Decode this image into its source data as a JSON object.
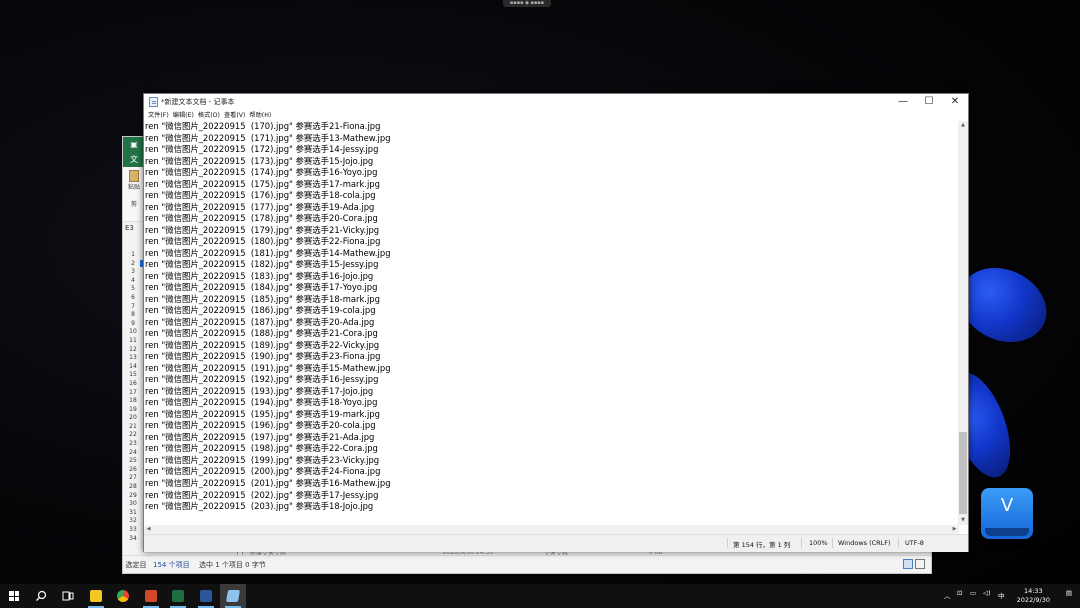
{
  "top_tab": "▪▪▪▪ ◆ ▪▪▪▪",
  "excel": {
    "tab_label": "文",
    "paste_label": "粘贴",
    "clipboard_label": "剪",
    "name_box": "E3",
    "row_numbers": [
      "1",
      "2",
      "3",
      "4",
      "5",
      "6",
      "7",
      "8",
      "9",
      "10",
      "11",
      "12",
      "13",
      "14",
      "15",
      "16",
      "17",
      "18",
      "19",
      "20",
      "21",
      "22",
      "23",
      "24",
      "25",
      "26",
      "27",
      "28",
      "29",
      "30",
      "31",
      "32",
      "33",
      "34"
    ],
    "peek_row": {
      "name": "新建文本文档",
      "date": "2022/9/30 14:53",
      "type": "文本文档",
      "size": "0 KB"
    },
    "status": {
      "mode": "选定目",
      "count": "154 个项目",
      "selection": "选中 1 个项目  0 字节"
    }
  },
  "notepad": {
    "title": "*新建文本文档 - 记事本",
    "window_buttons": {
      "minimize": "—",
      "maximize": "☐",
      "close": "✕"
    },
    "menu": [
      "文件(F)",
      "编辑(E)",
      "格式(O)",
      "查看(V)",
      "帮助(H)"
    ],
    "lines": [
      "ren \"微信图片_20220915  (170).jpg\" 参赛选手21-Fiona.jpg",
      "ren \"微信图片_20220915  (171).jpg\" 参赛选手13-Mathew.jpg",
      "ren \"微信图片_20220915  (172).jpg\" 参赛选手14-Jessy.jpg",
      "ren \"微信图片_20220915  (173).jpg\" 参赛选手15-Jojo.jpg",
      "ren \"微信图片_20220915  (174).jpg\" 参赛选手16-Yoyo.jpg",
      "ren \"微信图片_20220915  (175).jpg\" 参赛选手17-mark.jpg",
      "ren \"微信图片_20220915  (176).jpg\" 参赛选手18-cola.jpg",
      "ren \"微信图片_20220915  (177).jpg\" 参赛选手19-Ada.jpg",
      "ren \"微信图片_20220915  (178).jpg\" 参赛选手20-Cora.jpg",
      "ren \"微信图片_20220915  (179).jpg\" 参赛选手21-Vicky.jpg",
      "ren \"微信图片_20220915  (180).jpg\" 参赛选手22-Fiona.jpg",
      "ren \"微信图片_20220915  (181).jpg\" 参赛选手14-Mathew.jpg",
      "ren \"微信图片_20220915  (182).jpg\" 参赛选手15-Jessy.jpg",
      "ren \"微信图片_20220915  (183).jpg\" 参赛选手16-Jojo.jpg",
      "ren \"微信图片_20220915  (184).jpg\" 参赛选手17-Yoyo.jpg",
      "ren \"微信图片_20220915  (185).jpg\" 参赛选手18-mark.jpg",
      "ren \"微信图片_20220915  (186).jpg\" 参赛选手19-cola.jpg",
      "ren \"微信图片_20220915  (187).jpg\" 参赛选手20-Ada.jpg",
      "ren \"微信图片_20220915  (188).jpg\" 参赛选手21-Cora.jpg",
      "ren \"微信图片_20220915  (189).jpg\" 参赛选手22-Vicky.jpg",
      "ren \"微信图片_20220915  (190).jpg\" 参赛选手23-Fiona.jpg",
      "ren \"微信图片_20220915  (191).jpg\" 参赛选手15-Mathew.jpg",
      "ren \"微信图片_20220915  (192).jpg\" 参赛选手16-Jessy.jpg",
      "ren \"微信图片_20220915  (193).jpg\" 参赛选手17-Jojo.jpg",
      "ren \"微信图片_20220915  (194).jpg\" 参赛选手18-Yoyo.jpg",
      "ren \"微信图片_20220915  (195).jpg\" 参赛选手19-mark.jpg",
      "ren \"微信图片_20220915  (196).jpg\" 参赛选手20-cola.jpg",
      "ren \"微信图片_20220915  (197).jpg\" 参赛选手21-Ada.jpg",
      "ren \"微信图片_20220915  (198).jpg\" 参赛选手22-Cora.jpg",
      "ren \"微信图片_20220915  (199).jpg\" 参赛选手23-Vicky.jpg",
      "ren \"微信图片_20220915  (200).jpg\" 参赛选手24-Fiona.jpg",
      "ren \"微信图片_20220915  (201).jpg\" 参赛选手16-Mathew.jpg",
      "ren \"微信图片_20220915  (202).jpg\" 参赛选手17-Jessy.jpg",
      "ren \"微信图片_20220915  (203).jpg\" 参赛选手18-Jojo.jpg"
    ],
    "status": {
      "position": "第 154 行，第 1 列",
      "zoom": "100%",
      "line_ending": "Windows (CRLF)",
      "encoding": "UTF-8"
    }
  },
  "floating_app": {
    "label": "V"
  },
  "taskbar": {
    "apps": [
      {
        "name": "start",
        "color": "#ffffff"
      },
      {
        "name": "search-icon",
        "color": "#ffffff"
      },
      {
        "name": "task-view-icon",
        "color": "#ffffff"
      },
      {
        "name": "file-explorer-icon",
        "color": "#f3c623"
      },
      {
        "name": "chrome-icon",
        "color": "#e94235"
      },
      {
        "name": "powerpoint-icon",
        "color": "#d24726"
      },
      {
        "name": "excel-icon",
        "color": "#1d6f42"
      },
      {
        "name": "word-icon",
        "color": "#2b579a"
      },
      {
        "name": "notepad-icon",
        "color": "#8fc3ef"
      }
    ],
    "tray": {
      "ime": "中",
      "time": "14:33",
      "date": "2022/9/30"
    }
  }
}
